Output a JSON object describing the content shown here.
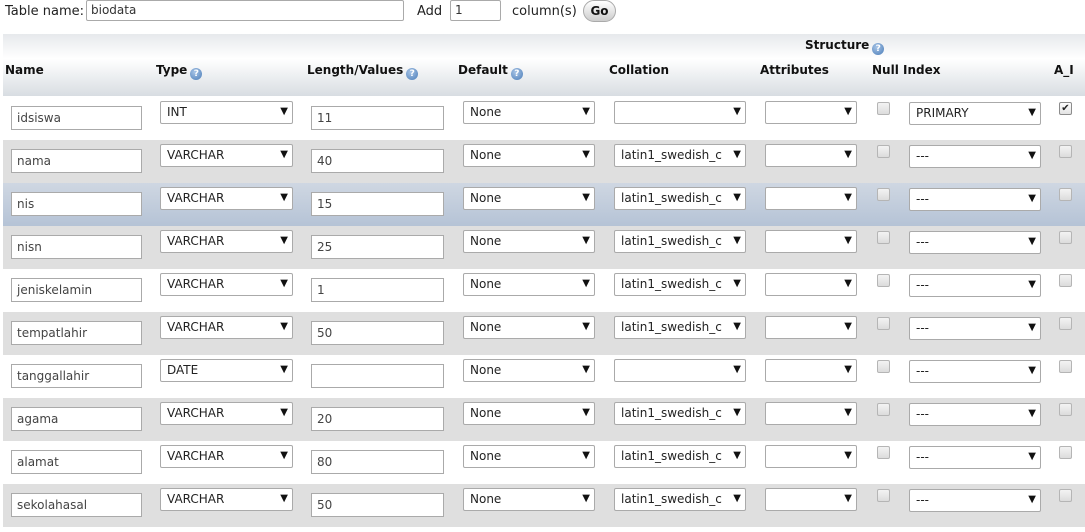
{
  "top": {
    "table_name_label": "Table name:",
    "table_name_value": "biodata",
    "add_label": "Add",
    "add_value": "1",
    "columns_label": "column(s)",
    "go_label": "Go"
  },
  "header": {
    "structure": "Structure",
    "name": "Name",
    "type": "Type",
    "length": "Length/Values",
    "default": "Default",
    "collation": "Collation",
    "attributes": "Attributes",
    "null": "Null",
    "index": "Index",
    "ai": "A_I",
    "help_icon_glyph": "?"
  },
  "rows": [
    {
      "name": "idsiswa",
      "type": "INT",
      "length": "11",
      "default": "None",
      "collation": "",
      "attributes": "",
      "null": false,
      "index": "PRIMARY",
      "ai": true
    },
    {
      "name": "nama",
      "type": "VARCHAR",
      "length": "40",
      "default": "None",
      "collation": "latin1_swedish_c",
      "attributes": "",
      "null": false,
      "index": "---",
      "ai": false
    },
    {
      "name": "nis",
      "type": "VARCHAR",
      "length": "15",
      "default": "None",
      "collation": "latin1_swedish_c",
      "attributes": "",
      "null": false,
      "index": "---",
      "ai": false
    },
    {
      "name": "nisn",
      "type": "VARCHAR",
      "length": "25",
      "default": "None",
      "collation": "latin1_swedish_c",
      "attributes": "",
      "null": false,
      "index": "---",
      "ai": false
    },
    {
      "name": "jeniskelamin",
      "type": "VARCHAR",
      "length": "1",
      "default": "None",
      "collation": "latin1_swedish_c",
      "attributes": "",
      "null": false,
      "index": "---",
      "ai": false
    },
    {
      "name": "tempatlahir",
      "type": "VARCHAR",
      "length": "50",
      "default": "None",
      "collation": "latin1_swedish_c",
      "attributes": "",
      "null": false,
      "index": "---",
      "ai": false
    },
    {
      "name": "tanggallahir",
      "type": "DATE",
      "length": "",
      "default": "None",
      "collation": "",
      "attributes": "",
      "null": false,
      "index": "---",
      "ai": false
    },
    {
      "name": "agama",
      "type": "VARCHAR",
      "length": "20",
      "default": "None",
      "collation": "latin1_swedish_c",
      "attributes": "",
      "null": false,
      "index": "---",
      "ai": false
    },
    {
      "name": "alamat",
      "type": "VARCHAR",
      "length": "80",
      "default": "None",
      "collation": "latin1_swedish_c",
      "attributes": "",
      "null": false,
      "index": "---",
      "ai": false
    },
    {
      "name": "sekolahasal",
      "type": "VARCHAR",
      "length": "50",
      "default": "None",
      "collation": "latin1_swedish_c",
      "attributes": "",
      "null": false,
      "index": "---",
      "ai": false
    }
  ],
  "icons": {
    "dropdown_arrow": "▼",
    "checkmark": "✔"
  }
}
